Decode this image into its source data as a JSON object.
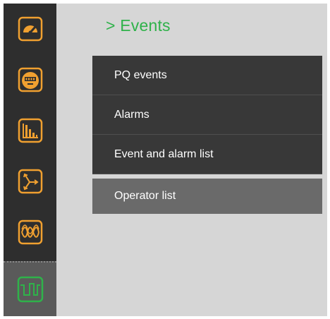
{
  "page": {
    "title": "> Events"
  },
  "menu": {
    "items": [
      {
        "label": "PQ events"
      },
      {
        "label": "Alarms"
      },
      {
        "label": "Event and alarm list"
      },
      {
        "label": "Operator list"
      }
    ]
  },
  "sidebar": {
    "buttons": [
      {
        "icon": "gauge-icon"
      },
      {
        "icon": "meter-icon"
      },
      {
        "icon": "bar-chart-icon"
      },
      {
        "icon": "phasor-icon"
      },
      {
        "icon": "waveform-icon"
      },
      {
        "icon": "events-icon",
        "active": true
      }
    ]
  },
  "colors": {
    "accent_orange": "#f0a030",
    "accent_green": "#2fb24a",
    "sidebar_bg": "#2e2e2e",
    "menu_bg": "#383838",
    "menu_selected_bg": "#6a6a6a",
    "content_bg": "#d6d6d6"
  }
}
